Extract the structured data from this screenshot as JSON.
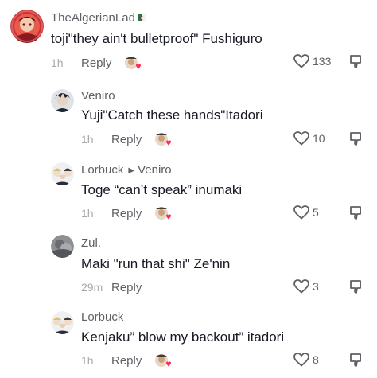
{
  "comments": [
    {
      "username": "TheAlgerianLad",
      "flag_icon": "algeria-flag-icon",
      "text": "toji\"they ain't bulletproof\" Fushiguro",
      "time": "1h",
      "reply_label": "Reply",
      "likes": "133",
      "avatar": "avatar-red-anime"
    },
    {
      "username": "Veniro",
      "text": "Yuji\"Catch these hands\"Itadori",
      "time": "1h",
      "reply_label": "Reply",
      "likes": "10",
      "avatar": "avatar-dark-anime"
    },
    {
      "username": "Lorbuck",
      "reply_to": "Veniro",
      "text": "Toge “can’t speak” inumaki",
      "time": "1h",
      "reply_label": "Reply",
      "likes": "5",
      "avatar": "avatar-group-anime"
    },
    {
      "username": "Zul.",
      "text": "Maki \"run that shi\" Ze'nin",
      "time": "29m",
      "reply_label": "Reply",
      "likes": "3",
      "avatar": "avatar-grey-photo"
    },
    {
      "username": "Lorbuck",
      "text": "Kenjaku” blow my backout” itadori",
      "time": "1h",
      "reply_label": "Reply",
      "likes": "8",
      "avatar": "avatar-group-anime"
    }
  ],
  "colors": {
    "text_primary": "#161823",
    "text_secondary": "#5f6066",
    "text_muted": "#a8a9ad",
    "heart_outline": "#5f6066",
    "react_heart": "#fe2c55"
  }
}
